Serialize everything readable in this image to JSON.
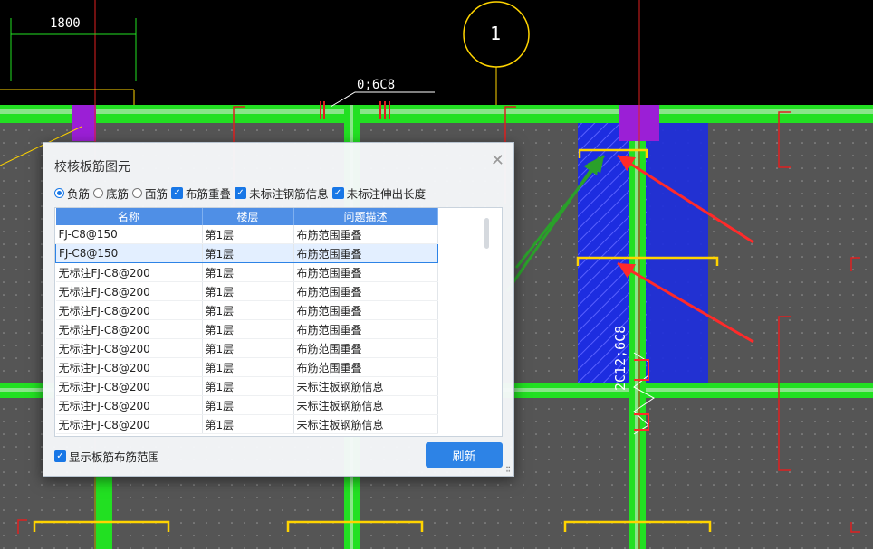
{
  "drawing": {
    "dim_label": "1800",
    "axis_label": "1",
    "rebar_label_top": "0;6C8",
    "rebar_label_vertical": "2C12;6C8"
  },
  "dialog": {
    "title": "校核板筋图元",
    "close_icon": "close-icon",
    "options": {
      "radio_negative": "负筋",
      "radio_bottom": "底筋",
      "radio_top": "面筋",
      "check_overlap": "布筋重叠",
      "check_unlabeled_info": "未标注钢筋信息",
      "check_unlabeled_length": "未标注伸出长度"
    },
    "selected_radio": "负筋",
    "table": {
      "columns": [
        "名称",
        "楼层",
        "问题描述"
      ],
      "rows": [
        {
          "name": "FJ-C8@150",
          "floor": "第1层",
          "issue": "布筋范围重叠"
        },
        {
          "name": "FJ-C8@150",
          "floor": "第1层",
          "issue": "布筋范围重叠"
        },
        {
          "name": "无标注FJ-C8@200",
          "floor": "第1层",
          "issue": "布筋范围重叠"
        },
        {
          "name": "无标注FJ-C8@200",
          "floor": "第1层",
          "issue": "布筋范围重叠"
        },
        {
          "name": "无标注FJ-C8@200",
          "floor": "第1层",
          "issue": "布筋范围重叠"
        },
        {
          "name": "无标注FJ-C8@200",
          "floor": "第1层",
          "issue": "布筋范围重叠"
        },
        {
          "name": "无标注FJ-C8@200",
          "floor": "第1层",
          "issue": "布筋范围重叠"
        },
        {
          "name": "无标注FJ-C8@200",
          "floor": "第1层",
          "issue": "布筋范围重叠"
        },
        {
          "name": "无标注FJ-C8@200",
          "floor": "第1层",
          "issue": "未标注板钢筋信息"
        },
        {
          "name": "无标注FJ-C8@200",
          "floor": "第1层",
          "issue": "未标注板钢筋信息"
        },
        {
          "name": "无标注FJ-C8@200",
          "floor": "第1层",
          "issue": "未标注板钢筋信息"
        }
      ],
      "selected_row": 1
    },
    "show_range_label": "显示板筋布筋范围",
    "refresh_label": "刷新"
  },
  "colors": {
    "beam": "#22e022",
    "column": "#9b1fd6",
    "rebar": "#ffd400",
    "highlight": "#1d2de0",
    "arrow_red": "#ff2a2a",
    "arrow_green": "#2aa02a",
    "accent": "#2d83e6"
  }
}
